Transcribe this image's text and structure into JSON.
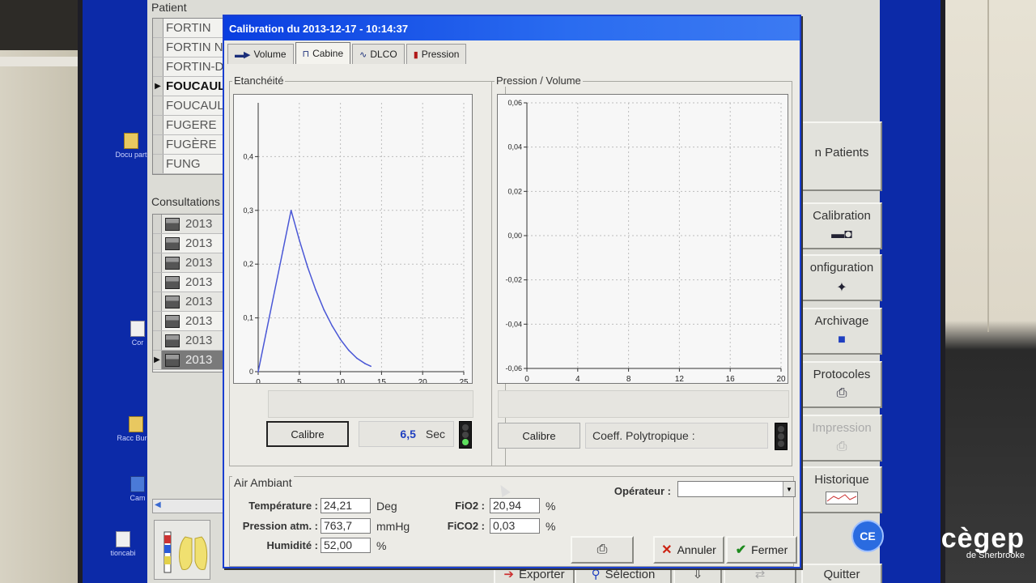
{
  "patient_panel": {
    "title": "Patient",
    "rows": [
      "FORTIN",
      "FORTIN N",
      "FORTIN-D",
      "FOUCAUL",
      "FOUCAUL",
      "FUGERE",
      "FUGÈRE",
      "FUNG"
    ],
    "selected_index": 3
  },
  "consultations_panel": {
    "title": "Consultations",
    "rows": [
      "2013",
      "2013",
      "2013",
      "2013",
      "2013",
      "2013",
      "2013",
      "2013"
    ],
    "selected_index": 7
  },
  "desktop": {
    "icon1": "Docu part",
    "icon2": "Cor",
    "icon3": "Racc Burea",
    "icon4": "Cam",
    "icon5": "tioncabi"
  },
  "side_buttons": {
    "patients": "n Patients",
    "calibration": "Calibration",
    "configuration": "onfiguration",
    "archivage": "Archivage",
    "protocoles": "Protocoles",
    "impression": "Impression",
    "historique": "Historique"
  },
  "bottom_buttons": {
    "exporter": "Exporter",
    "selection": "Sélection",
    "quitter": "Quitter"
  },
  "dialog": {
    "title": "Calibration du 2013-12-17 - 10:14:37",
    "tabs": [
      {
        "label": "Volume",
        "icon": "piston-icon"
      },
      {
        "label": "Cabine",
        "icon": "cabin-icon"
      },
      {
        "label": "DLCO",
        "icon": "wave-icon"
      },
      {
        "label": "Pression",
        "icon": "pressure-gauge-icon"
      }
    ],
    "active_tab": 1,
    "etancheite": {
      "title": "Etanchéité",
      "calibre_label": "Calibre",
      "time_value": "6,5",
      "time_unit": "Sec"
    },
    "pression_volume": {
      "title": "Pression / Volume",
      "calibre_label": "Calibre",
      "coeff_label": "Coeff. Polytropique :"
    },
    "air_ambiant": {
      "title": "Air Ambiant",
      "temperature_label": "Température :",
      "temperature_value": "24,21",
      "temperature_unit": "Deg",
      "pression_label": "Pression atm. :",
      "pression_value": "763,7",
      "pression_unit": "mmHg",
      "humidite_label": "Humidité :",
      "humidite_value": "52,00",
      "humidite_unit": "%",
      "fio2_label": "FiO2 :",
      "fio2_value": "20,94",
      "fio2_unit": "%",
      "fico2_label": "FiCO2 :",
      "fico2_value": "0,03",
      "fico2_unit": "%"
    },
    "operateur_label": "Opérateur :",
    "operateur_value": "",
    "annuler_label": "Annuler",
    "fermer_label": "Fermer"
  },
  "logo": {
    "big": "cègep",
    "small": "de Sherbrooke"
  },
  "chart_data": [
    {
      "type": "line",
      "title": "Etanchéité",
      "xlim": [
        0,
        25
      ],
      "ylim": [
        0,
        0.5
      ],
      "xticks": [
        "0",
        "5",
        "10",
        "15",
        "20",
        "25"
      ],
      "yticks": [
        "0",
        "0,1",
        "0,2",
        "0,3",
        "0,4"
      ],
      "xtick_values": [
        0,
        5,
        10,
        15,
        20,
        25
      ],
      "ytick_values": [
        0,
        0.1,
        0.2,
        0.3,
        0.4
      ],
      "grid": true,
      "color": "#4a57d6",
      "series": [
        {
          "x": [
            0,
            1,
            2,
            3,
            4,
            5,
            6,
            7,
            8,
            9,
            10,
            11,
            12,
            13,
            13.7
          ],
          "y": [
            0.0,
            0.075,
            0.15,
            0.225,
            0.3,
            0.245,
            0.195,
            0.152,
            0.115,
            0.085,
            0.06,
            0.04,
            0.025,
            0.015,
            0.01
          ]
        }
      ]
    },
    {
      "type": "line",
      "title": "Pression / Volume",
      "xlim": [
        0,
        20
      ],
      "ylim": [
        -0.06,
        0.06
      ],
      "xticks": [
        "0",
        "4",
        "8",
        "12",
        "16",
        "20"
      ],
      "yticks": [
        "0,06",
        "0,04",
        "0,02",
        "0,00",
        "-0,02",
        "-0,04",
        "-0,06"
      ],
      "xtick_values": [
        0,
        4,
        8,
        12,
        16,
        20
      ],
      "ytick_values": [
        0.06,
        0.04,
        0.02,
        0,
        -0.02,
        -0.04,
        -0.06
      ],
      "grid": true,
      "series": []
    }
  ]
}
